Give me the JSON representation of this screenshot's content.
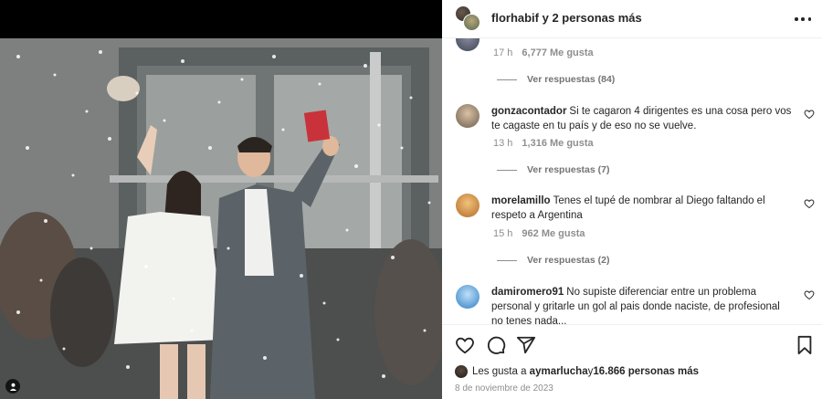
{
  "header": {
    "username": "florhabif",
    "others_text": " y 2 personas más"
  },
  "comments": [
    {
      "meta_time": "17 h",
      "likes": "6,777 Me gusta",
      "replies_label": "Ver respuestas (84)"
    },
    {
      "username": "gonzacontador",
      "text": "Si te cagaron 4 dirigentes es una cosa pero vos te cagaste en tu país y de eso no se vuelve.",
      "meta_time": "13 h",
      "likes": "1,316 Me gusta",
      "replies_label": "Ver respuestas (7)",
      "avatar_color": "#9a8a78"
    },
    {
      "username": "morelamillo",
      "text": "Tenes el tupé de nombrar al Diego faltando el respeto a Argentina",
      "meta_time": "15 h",
      "likes": "962 Me gusta",
      "replies_label": "Ver respuestas (2)",
      "avatar_color": "#e4a24a"
    },
    {
      "username": "damiromero91",
      "text": "No supiste diferenciar entre un problema personal y gritarle un gol al pais donde naciste, de profesional no tenes nada...",
      "avatar_color": "#3f8fd6"
    }
  ],
  "footer": {
    "liked_prefix": "Les gusta a ",
    "liked_user": "aymarlucha",
    "liked_mid": " y ",
    "liked_count": "16.866 personas más",
    "date": "8 de noviembre de 2023"
  },
  "icons": {
    "more": "more-options-icon",
    "like": "heart-icon",
    "comment": "comment-icon",
    "share": "share-icon",
    "save": "bookmark-icon"
  }
}
